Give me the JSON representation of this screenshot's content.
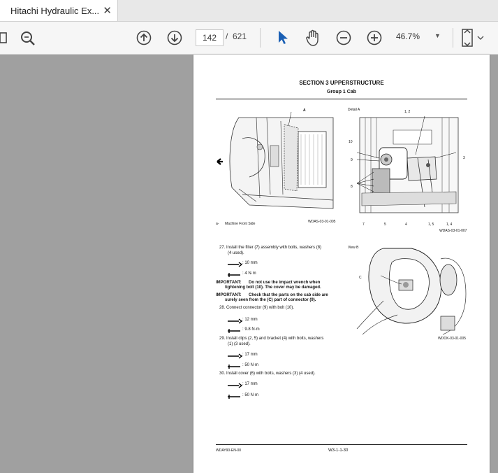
{
  "tab": {
    "title": "Hitachi Hydraulic Ex...",
    "close_glyph": "✕"
  },
  "toolbar": {
    "current_page": "142",
    "page_separator": "/",
    "total_pages": "621",
    "zoom": "46.7%",
    "icons": [
      "sidebar-icon",
      "zoom-search-icon",
      "page-up-icon",
      "page-down-icon",
      "select-cursor-icon",
      "hand-tool-icon",
      "zoom-out-icon",
      "zoom-in-icon",
      "fit-page-icon"
    ]
  },
  "document": {
    "section_title": "SECTION 3 UPPERSTRUCTURE",
    "group_title": "Group 1 Cab",
    "fig1": {
      "label_a": "A",
      "caption_left": "a-",
      "caption_text": "Machine Front Side",
      "code": "WDAS-03-01-005"
    },
    "fig2": {
      "title": "Detail A",
      "labels": [
        "1, 2",
        "10",
        "9",
        "8",
        "3",
        "7",
        "5",
        "4",
        "1, 5",
        "1, 4"
      ],
      "code": "WDAS-03-01-007"
    },
    "fig3": {
      "title": "View B",
      "label_c": "C",
      "code": "WDOK-03-01-005"
    },
    "steps": [
      {
        "text": "27.  Install the filter (7) assembly with bolts, washers (8)",
        "text2": "(4 used).",
        "wrench": ": 10 mm",
        "torque": ": 4 N·m"
      },
      {
        "text": "28.  Connect connector (9) with bolt (10).",
        "wrench": ": 12 mm",
        "torque": ": 9.8 N·m"
      },
      {
        "text": "29.  Install clips (2, 5) and bracket (4) with bolts, washers",
        "text2": "(1) (3 used).",
        "wrench": ": 17 mm",
        "torque": ": 50 N·m"
      },
      {
        "text": "30.  Install cover (6) with bolts, washers (3) (4 used).",
        "wrench": ": 17 mm",
        "torque": ": 50 N·m"
      }
    ],
    "important1_head": "IMPORTANT:",
    "important1_a": "Do not use the impact wrench when",
    "important1_b": "tightening bolt (10). The cover may be damaged.",
    "important2_head": "IMPORTANT:",
    "important2_a": "Check that the parts on the cab side are",
    "important2_b": "surely seen from the (C) part of connector (9).",
    "footer_left": "WDAY90-EN-00",
    "footer_center": "W3-1-1-30"
  }
}
